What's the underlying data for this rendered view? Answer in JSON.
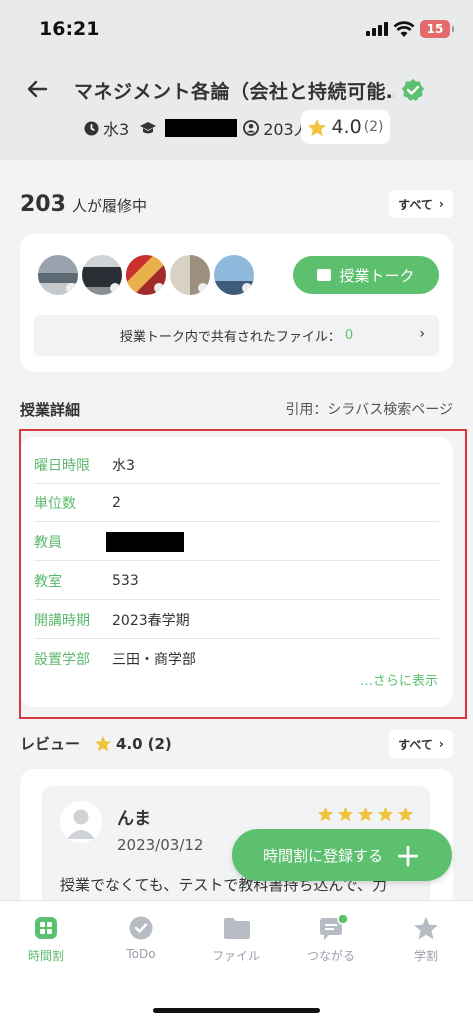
{
  "status": {
    "time": "16:21",
    "battery": "15"
  },
  "header": {
    "title": "マネジメント各論（会社と持続可能…",
    "period": "水3",
    "enrolled": "203人",
    "rating": "4.0",
    "rating_count": "(2)"
  },
  "enrolled_section": {
    "count": "203",
    "label": "人が履修中",
    "all_label": "すべて",
    "talk_button": "授業トーク",
    "files_label": "授業トーク内で共有されたファイル：",
    "files_count": "0"
  },
  "details": {
    "title": "授業詳細",
    "cite": "引用：シラバス検索ページ",
    "rows": [
      {
        "key": "曜日時限",
        "value": "水3"
      },
      {
        "key": "単位数",
        "value": "2"
      },
      {
        "key": "教員",
        "value": ""
      },
      {
        "key": "教室",
        "value": "533"
      },
      {
        "key": "開講時期",
        "value": "2023春学期"
      },
      {
        "key": "設置学部",
        "value": "三田・商学部"
      }
    ],
    "more": "…さらに表示"
  },
  "reviews": {
    "title": "レビュー",
    "rating": "4.0",
    "count": "(2)",
    "all_label": "すべて",
    "items": [
      {
        "name": "んま",
        "date": "2023/03/12",
        "stars": 5,
        "text": "授業でなくても、テストで教科書持ち込んで、力"
      }
    ]
  },
  "fab": {
    "label": "時間割に登録する"
  },
  "nav": [
    {
      "label": "時間割",
      "icon": "timetable-icon",
      "active": true
    },
    {
      "label": "ToDo",
      "icon": "check-icon",
      "active": false
    },
    {
      "label": "ファイル",
      "icon": "folder-icon",
      "active": false
    },
    {
      "label": "つながる",
      "icon": "chat-icon",
      "active": false
    },
    {
      "label": "学割",
      "icon": "star-icon",
      "active": false
    }
  ],
  "colors": {
    "accent": "#5cc06f",
    "highlight_border": "#d9363e",
    "star": "#f0c33c"
  }
}
